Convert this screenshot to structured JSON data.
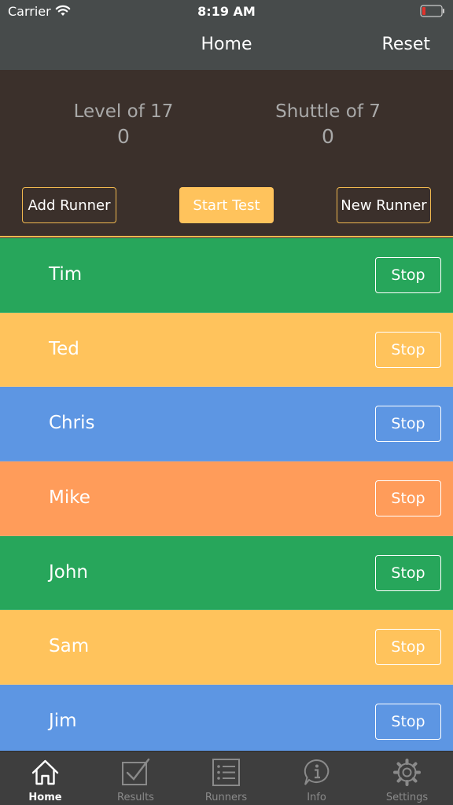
{
  "status_bar": {
    "carrier": "Carrier",
    "time": "8:19 AM"
  },
  "nav": {
    "title": "Home",
    "reset_label": "Reset"
  },
  "stats": {
    "level_label": "Level of 17",
    "level_value": "0",
    "shuttle_label": "Shuttle of 7",
    "shuttle_value": "0"
  },
  "actions": {
    "add_runner": "Add Runner",
    "start_test": "Start Test",
    "new_runner": "New Runner"
  },
  "runners": [
    {
      "name": "Tim",
      "stop": "Stop",
      "color": "#27a65b"
    },
    {
      "name": "Ted",
      "stop": "Stop",
      "color": "#ffc35c"
    },
    {
      "name": "Chris",
      "stop": "Stop",
      "color": "#5d96e3"
    },
    {
      "name": "Mike",
      "stop": "Stop",
      "color": "#ff9c5a"
    },
    {
      "name": "John",
      "stop": "Stop",
      "color": "#27a65b"
    },
    {
      "name": "Sam",
      "stop": "Stop",
      "color": "#ffc35c"
    },
    {
      "name": "Jim",
      "stop": "Stop",
      "color": "#5d96e3"
    }
  ],
  "tabs": [
    {
      "label": "Home",
      "icon": "home-icon",
      "active": true
    },
    {
      "label": "Results",
      "icon": "checklist-icon",
      "active": false
    },
    {
      "label": "Runners",
      "icon": "list-icon",
      "active": false
    },
    {
      "label": "Info",
      "icon": "info-icon",
      "active": false
    },
    {
      "label": "Settings",
      "icon": "gear-icon",
      "active": false
    }
  ],
  "colors": {
    "accent": "#f0b84f",
    "panel": "#3b302b",
    "navbar": "#474b4b",
    "battery_low": "#e0332c"
  }
}
